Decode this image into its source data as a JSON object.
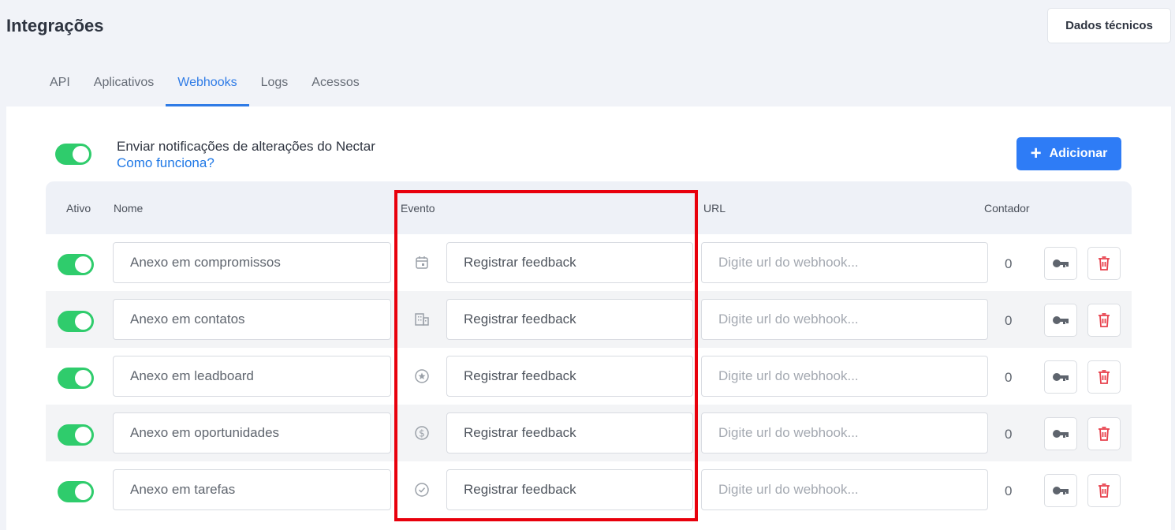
{
  "header": {
    "title": "Integrações",
    "tech_button": "Dados técnicos"
  },
  "tabs": [
    {
      "label": "API",
      "active": false
    },
    {
      "label": "Aplicativos",
      "active": false
    },
    {
      "label": "Webhooks",
      "active": true
    },
    {
      "label": "Logs",
      "active": false
    },
    {
      "label": "Acessos",
      "active": false
    }
  ],
  "notify": {
    "enabled": true,
    "title": "Enviar notificações de alterações do Nectar",
    "link": "Como funciona?"
  },
  "add_button": "Adicionar",
  "table": {
    "headers": {
      "active": "Ativo",
      "name": "Nome",
      "event": "Evento",
      "url": "URL",
      "counter": "Contador"
    },
    "rows": [
      {
        "active": true,
        "name": "Anexo em compromissos",
        "event_icon": "calendar-icon",
        "event": "Registrar feedback",
        "url_placeholder": "Digite url do webhook...",
        "counter": "0"
      },
      {
        "active": true,
        "name": "Anexo em contatos",
        "event_icon": "building-icon",
        "event": "Registrar feedback",
        "url_placeholder": "Digite url do webhook...",
        "counter": "0"
      },
      {
        "active": true,
        "name": "Anexo em leadboard",
        "event_icon": "star-circle-icon",
        "event": "Registrar feedback",
        "url_placeholder": "Digite url do webhook...",
        "counter": "0"
      },
      {
        "active": true,
        "name": "Anexo em oportunidades",
        "event_icon": "dollar-circle-icon",
        "event": "Registrar feedback",
        "url_placeholder": "Digite url do webhook...",
        "counter": "0"
      },
      {
        "active": true,
        "name": "Anexo em tarefas",
        "event_icon": "check-circle-icon",
        "event": "Registrar feedback",
        "url_placeholder": "Digite url do webhook...",
        "counter": "0"
      }
    ]
  },
  "colors": {
    "accent": "#2e7cf6",
    "toggle_on": "#2fcc6c",
    "delete": "#e8434e",
    "highlight": "#e8000c"
  }
}
